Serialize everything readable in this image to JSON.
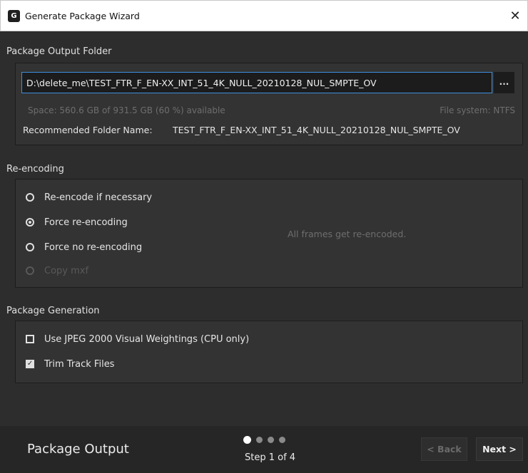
{
  "window": {
    "title": "Generate Package Wizard",
    "app_icon_text": "G",
    "close_glyph": "✕"
  },
  "output_folder": {
    "section_label": "Package Output Folder",
    "path_value": "D:\\delete_me\\TEST_FTR_F_EN-XX_INT_51_4K_NULL_20210128_NUL_SMPTE_OV",
    "browse_label": "...",
    "space_text": "Space: 560.6 GB of 931.5 GB (60 %) available",
    "filesystem_text": "File system: NTFS",
    "recommended_label": "Recommended Folder Name:",
    "recommended_value": "TEST_FTR_F_EN-XX_INT_51_4K_NULL_20210128_NUL_SMPTE_OV"
  },
  "reencoding": {
    "section_label": "Re-encoding",
    "options": [
      {
        "label": "Re-encode if necessary",
        "selected": false,
        "disabled": false
      },
      {
        "label": "Force re-encoding",
        "selected": true,
        "disabled": false
      },
      {
        "label": "Force no re-encoding",
        "selected": false,
        "disabled": false
      },
      {
        "label": "Copy mxf",
        "selected": false,
        "disabled": true
      }
    ],
    "hint": "All frames get re-encoded."
  },
  "package_generation": {
    "section_label": "Package Generation",
    "options": [
      {
        "label": "Use JPEG 2000 Visual Weightings (CPU only)",
        "checked": false
      },
      {
        "label": "Trim Track Files",
        "checked": true
      }
    ]
  },
  "footer": {
    "page_name": "Package Output",
    "step_text": "Step 1 of 4",
    "step_current": 1,
    "step_total": 4,
    "back_label": "< Back",
    "next_label": "Next >"
  },
  "colors": {
    "background": "#2d2d2d",
    "panel": "#333333",
    "input_focus": "#3d8de0",
    "footer": "#262626"
  }
}
